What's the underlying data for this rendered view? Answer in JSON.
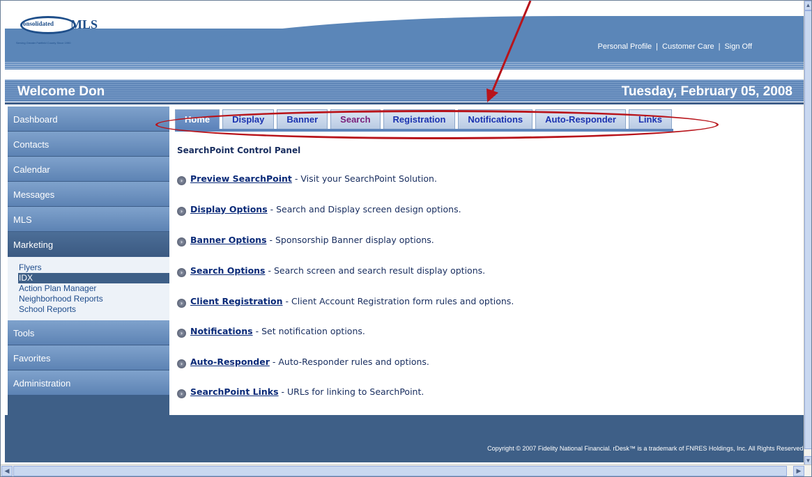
{
  "header": {
    "logo_mark": "onsolidated",
    "logo_text": "MLS",
    "logo_tagline": "Serving Greater Fairfield County Since 1990",
    "links": [
      "Personal Profile",
      "Customer Care",
      "Sign Off"
    ],
    "link_separator": "|",
    "welcome": "Welcome Don",
    "date": "Tuesday, February 05, 2008"
  },
  "sidebar": {
    "items": [
      {
        "label": "Dashboard"
      },
      {
        "label": "Contacts"
      },
      {
        "label": "Calendar"
      },
      {
        "label": "Messages"
      },
      {
        "label": "MLS"
      },
      {
        "label": "Marketing"
      }
    ],
    "sub_items": [
      "Flyers",
      "IDX",
      "Action Plan Manager",
      "Neighborhood Reports",
      "School Reports"
    ],
    "items_after": [
      {
        "label": "Tools"
      },
      {
        "label": "Favorites"
      },
      {
        "label": "Administration"
      }
    ]
  },
  "tabs": [
    "Home",
    "Display",
    "Banner",
    "Search",
    "Registration",
    "Notifications",
    "Auto-Responder",
    "Links"
  ],
  "panel": {
    "title": "SearchPoint Control Panel",
    "items": [
      {
        "link": "Preview SearchPoint",
        "desc": " - Visit your SearchPoint Solution."
      },
      {
        "link": "Display Options",
        "desc": " - Search and Display screen design options."
      },
      {
        "link": "Banner Options",
        "desc": " - Sponsorship Banner display options."
      },
      {
        "link": "Search Options",
        "desc": " - Search screen and search result display options."
      },
      {
        "link": "Client Registration",
        "desc": " - Client Account Registration form rules and options."
      },
      {
        "link": "Notifications",
        "desc": " - Set notification options."
      },
      {
        "link": "Auto-Responder",
        "desc": " - Auto-Responder rules and options."
      },
      {
        "link": "SearchPoint Links",
        "desc": " - URLs for linking to SearchPoint."
      }
    ]
  },
  "footer": {
    "copyright": "Copyright © 2007 Fidelity National Financial. rDesk™ is a trademark of FNRES Holdings, Inc. All Rights Reserved."
  },
  "colors": {
    "header_blue": "#5b86b8",
    "nav_dark": "#3e5f87",
    "tab_link": "#1b33b0",
    "annotation_red": "#b8141b"
  },
  "icons": [
    "bullet-arrow-icon",
    "scroll-up-icon",
    "scroll-down-icon",
    "scroll-left-icon",
    "scroll-right-icon"
  ]
}
